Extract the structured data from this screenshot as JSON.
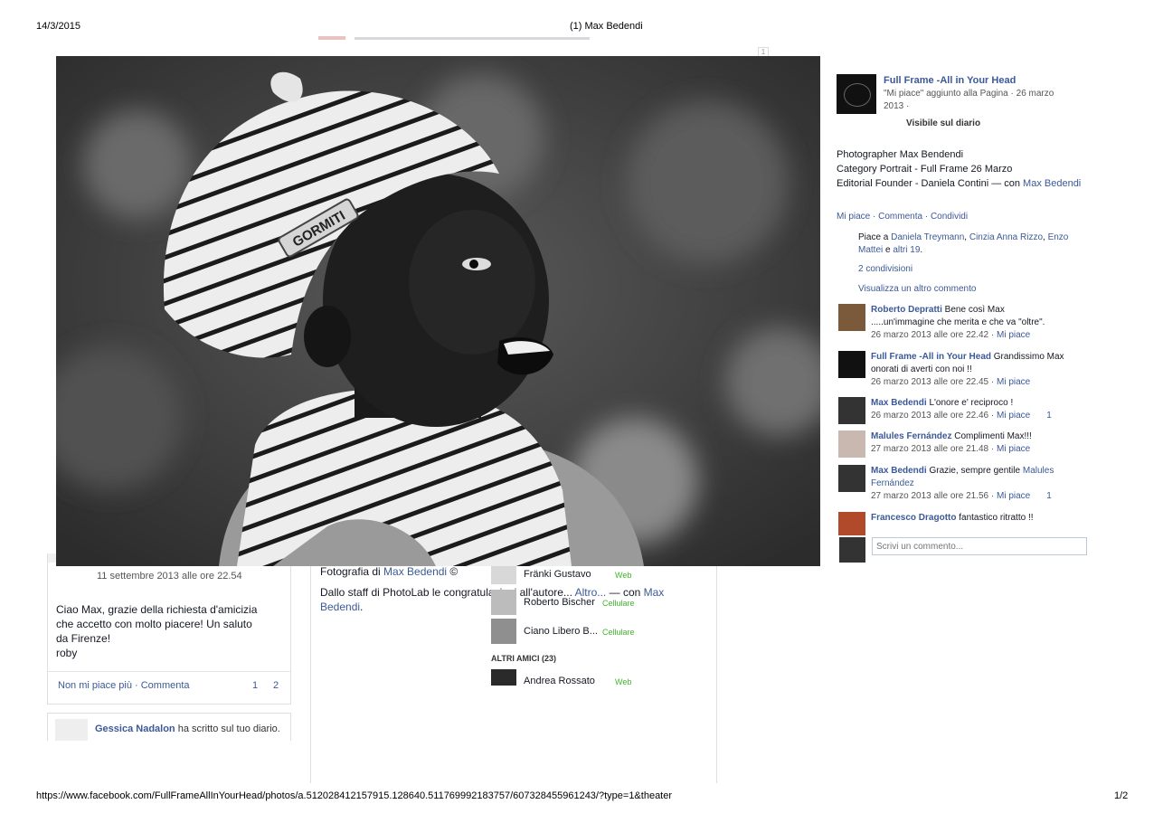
{
  "print_header": {
    "date": "14/3/2015",
    "title": "(1) Max Bedendi"
  },
  "print_footer": {
    "url": "https://www.facebook.com/FullFrameAllInYourHead/photos/a.512028412157915.128640.511769992183757/607328455961243/?type=1&theater",
    "page": "1/2"
  },
  "background": {
    "left_post": {
      "time": "11 settembre 2013 alle ore 22.54",
      "message": [
        "Ciao Max, grazie della richiesta d'amicizia",
        "che accetto con molto piacere! Un saluto",
        "da Firenze!",
        "roby"
      ],
      "unlike": "Non mi piace più",
      "comment": "Commenta",
      "likes_count": "1",
      "comments_count": "2",
      "next_author": "Gessica Nadalon",
      "next_text": "ha scritto sul tuo diario."
    },
    "center_post": {
      "line1_prefix": "Fotografia di ",
      "line1_link": "Max Bedendi",
      "line1_suffix": " ©",
      "line2_prefix": "Dallo staff di PhotoLab le congratulazioni all'autore... ",
      "altro": "Altro...",
      "with": " — con ",
      "with_name": "Max Bedendi",
      "with_end": "."
    },
    "chat": {
      "friends": [
        {
          "name": "Fränki Gustavo",
          "status": "Web"
        },
        {
          "name": "Roberto Bischer",
          "status": "Cellulare"
        },
        {
          "name": "Ciano Libero B...",
          "status": "Cellulare"
        }
      ],
      "other_header": "ALTRI AMICI (23)",
      "other": [
        {
          "name": "Andrea Rossato",
          "status": "Web"
        }
      ]
    }
  },
  "theater": {
    "page_name": "Full Frame -All in Your Head",
    "page_action": "\"Mi piace\" aggiunto alla Pagina · 26 marzo",
    "page_action2": "2013 ·",
    "visibility": "Visibile sul diario",
    "caption": [
      "Photographer Max Bendendi",
      "Category Portrait - Full Frame 26 Marzo"
    ],
    "caption3_prefix": "Editorial Founder - Daniela Contini — con ",
    "caption3_link": "Max Bedendi",
    "actions": {
      "like": "Mi piace",
      "comment": "Commenta",
      "share": "Condividi"
    },
    "likes": {
      "prefix": "Piace a ",
      "n1": "Daniela Treymann",
      "n2": "Cinzia Anna Rizzo",
      "n3": "Enzo",
      "n3b": "Mattei",
      "and": " e ",
      "others": "altri 19",
      "end": "."
    },
    "shares": "2 condivisioni",
    "more_comments": "Visualizza un altro commento",
    "comments": [
      {
        "name": "Roberto Depratti",
        "text": " Bene così Max",
        "text2": ".....un'immagine che merita e che va \"oltre\".",
        "time": "26 marzo 2013 alle ore 22.42",
        "like": "Mi piace",
        "count": ""
      },
      {
        "name": "Full Frame -All in Your Head",
        "text": " Grandissimo Max",
        "text2": "onorati di averti con noi !!",
        "time": "26 marzo 2013 alle ore 22.45",
        "like": "Mi piace",
        "count": ""
      },
      {
        "name": "Max Bedendi",
        "text": " L'onore e' reciproco !",
        "text2": "",
        "time": "26 marzo 2013 alle ore 22.46",
        "like": "Mi piace",
        "count": "1"
      },
      {
        "name": "Malules Fernández",
        "text": " Complimenti Max!!!",
        "text2": "",
        "time": "27 marzo 2013 alle ore 21.48",
        "like": "Mi piace",
        "count": ""
      },
      {
        "name": "Max Bedendi",
        "text": " Grazie, sempre gentile ",
        "link": "Malules",
        "text2link": "Fernández",
        "time": "27 marzo 2013 alle ore 21.56",
        "like": "Mi piace",
        "count": "1"
      },
      {
        "name": "Francesco Dragotto",
        "text": " fantastico ritratto !!",
        "text2": "",
        "time": "",
        "like": "",
        "count": ""
      }
    ],
    "comment_placeholder": "Scrivi un commento...",
    "photo_alt": "Portrait of a smiling boy wearing a striped knit hat and scarf",
    "hat_text": "GORMITI"
  }
}
